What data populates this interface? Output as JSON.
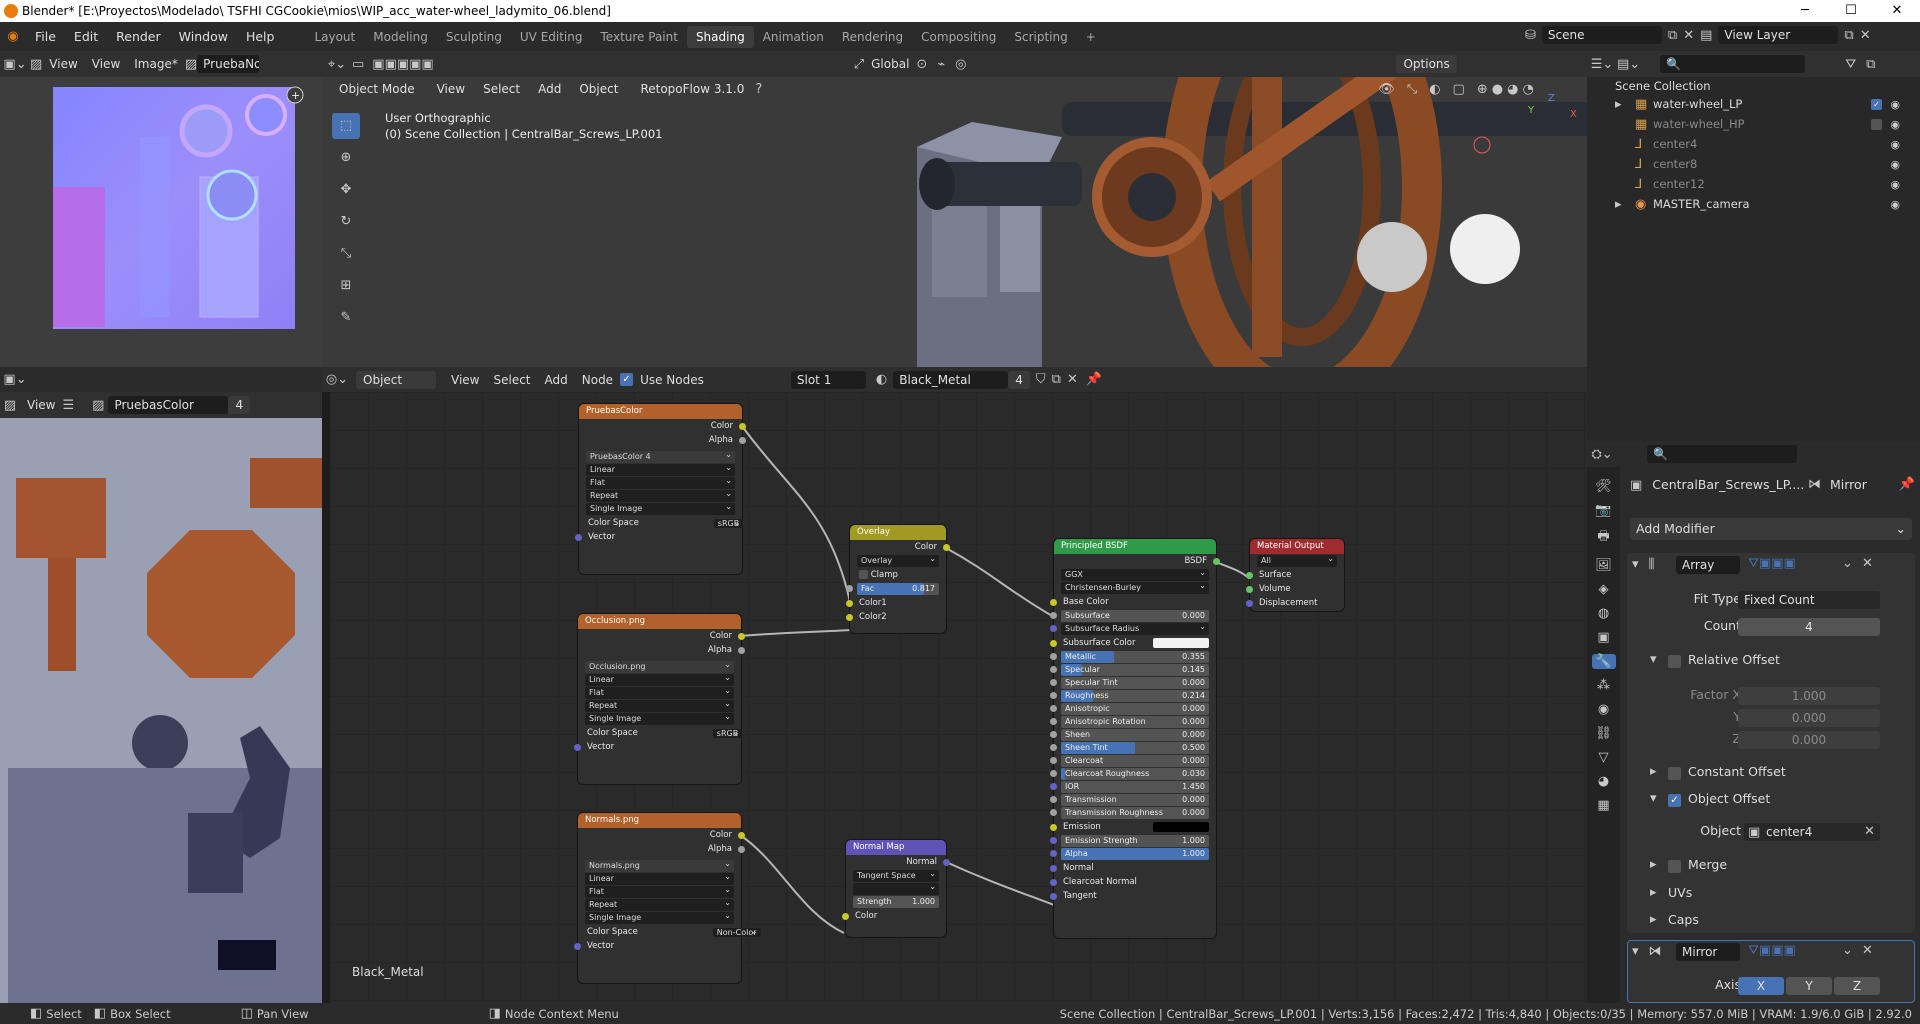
{
  "window": {
    "title": "Blender* [E:\\Proyectos\\Modelado\\ TSFHI CGCookie\\mios\\WIP_acc_water-wheel_ladymito_06.blend]",
    "min": "─",
    "max": "☐",
    "close": "✕"
  },
  "menu": [
    "File",
    "Edit",
    "Render",
    "Window",
    "Help"
  ],
  "workspaces": [
    "Layout",
    "Modeling",
    "Sculpting",
    "UV Editing",
    "Texture Paint",
    "Shading",
    "Animation",
    "Rendering",
    "Compositing",
    "Scripting"
  ],
  "workspace_add": "+",
  "scene": {
    "name": "Scene",
    "view_layer": "View Layer"
  },
  "image_editor_top": {
    "view": "View",
    "view2": "View",
    "image": "Image*",
    "image_name": "PruebaNorm"
  },
  "image_editor_bottom": {
    "view": "View",
    "image_name": "PruebasColor",
    "users": "4"
  },
  "viewport": {
    "transform": "Global",
    "options": "Options",
    "mode": "Object Mode",
    "view": "View",
    "select": "Select",
    "add": "Add",
    "object": "Object",
    "addon": "RetopoFlow 3.1.0",
    "view_name": "User Orthographic",
    "collection_path": "(0) Scene Collection | CentralBar_Screws_LP.001",
    "gizmo_x": "X",
    "gizmo_y": "Y",
    "gizmo_z": "Z"
  },
  "node_header": {
    "object": "Object",
    "view": "View",
    "select": "Select",
    "add": "Add",
    "node": "Node",
    "use_nodes": "Use Nodes",
    "slot": "Slot 1",
    "material": "Black_Metal",
    "users": "4"
  },
  "material_label": "Black_Metal",
  "nodes": {
    "pruebas": {
      "title": "PruebasColor",
      "out1": "Color",
      "out2": "Alpha",
      "img": "PruebasColor",
      "users": "4",
      "interp": "Linear",
      "proj": "Flat",
      "ext": "Repeat",
      "src": "Single Image",
      "cs_label": "Color Space",
      "cs": "sRGB",
      "vec": "Vector"
    },
    "occlusion": {
      "title": "Occlusion.png",
      "out1": "Color",
      "out2": "Alpha",
      "img": "Occlusion.png",
      "interp": "Linear",
      "proj": "Flat",
      "ext": "Repeat",
      "src": "Single Image",
      "cs_label": "Color Space",
      "cs": "sRGB",
      "vec": "Vector"
    },
    "normals": {
      "title": "Normals.png",
      "out1": "Color",
      "out2": "Alpha",
      "img": "Normals.png",
      "interp": "Linear",
      "proj": "Flat",
      "ext": "Repeat",
      "src": "Single Image",
      "cs_label": "Color Space",
      "cs": "Non-Color",
      "vec": "Vector"
    },
    "overlay": {
      "title": "Overlay",
      "out": "Color",
      "blend": "Overlay",
      "clamp": "Clamp",
      "fac": "Fac",
      "fac_val": "0.817",
      "c1": "Color1",
      "c2": "Color2"
    },
    "normalmap": {
      "title": "Normal Map",
      "out": "Normal",
      "space": "Tangent Space",
      "strength": "Strength",
      "strength_val": "1.000",
      "color": "Color"
    },
    "bsdf": {
      "title": "Principled BSDF",
      "out": "BSDF",
      "dist": "GGX",
      "sss": "Christensen-Burley",
      "base": "Base Color",
      "rows": [
        {
          "l": "Subsurface",
          "v": "0.000",
          "f": 0
        },
        {
          "l": "Subsurface Radius",
          "v": "",
          "f": 0,
          "sel": true
        },
        {
          "l": "Subsurface Color",
          "v": "",
          "f": 0,
          "white": true
        },
        {
          "l": "Metallic",
          "v": "0.355",
          "f": 0.355
        },
        {
          "l": "Specular",
          "v": "0.145",
          "f": 0.145
        },
        {
          "l": "Specular Tint",
          "v": "0.000",
          "f": 0
        },
        {
          "l": "Roughness",
          "v": "0.214",
          "f": 0.214
        },
        {
          "l": "Anisotropic",
          "v": "0.000",
          "f": 0
        },
        {
          "l": "Anisotropic Rotation",
          "v": "0.000",
          "f": 0
        },
        {
          "l": "Sheen",
          "v": "0.000",
          "f": 0
        },
        {
          "l": "Sheen Tint",
          "v": "0.500",
          "f": 0.5
        },
        {
          "l": "Clearcoat",
          "v": "0.000",
          "f": 0
        },
        {
          "l": "Clearcoat Roughness",
          "v": "0.030",
          "f": 0.03
        },
        {
          "l": "IOR",
          "v": "1.450",
          "f": 0
        },
        {
          "l": "Transmission",
          "v": "0.000",
          "f": 0
        },
        {
          "l": "Transmission Roughness",
          "v": "0.000",
          "f": 0
        },
        {
          "l": "Emission",
          "v": "",
          "f": 0,
          "black": true
        },
        {
          "l": "Emission Strength",
          "v": "1.000",
          "f": 0
        },
        {
          "l": "Alpha",
          "v": "1.000",
          "f": 1
        }
      ],
      "normal": "Normal",
      "cc_normal": "Clearcoat Normal",
      "tangent": "Tangent"
    },
    "matout": {
      "title": "Material Output",
      "target": "All",
      "surface": "Surface",
      "volume": "Volume",
      "disp": "Displacement"
    }
  },
  "outliner": {
    "title": "Scene Collection",
    "items": [
      {
        "name": "water-wheel_LP",
        "dim": false
      },
      {
        "name": "water-wheel_HP",
        "dim": true
      },
      {
        "name": "center4",
        "dim": true
      },
      {
        "name": "center8",
        "dim": true
      },
      {
        "name": "center12",
        "dim": true
      },
      {
        "name": "MASTER_camera",
        "dim": false
      }
    ]
  },
  "properties": {
    "object_name": "CentralBar_Screws_LP....",
    "modifier_name": "Mirror",
    "add_modifier": "Add Modifier",
    "array": {
      "name": "Array",
      "fit_type_label": "Fit Type",
      "fit_type": "Fixed Count",
      "count_label": "Count",
      "count": "4",
      "relative": "Relative Offset",
      "fx_label": "Factor X",
      "fx": "1.000",
      "fy_label": "Y",
      "fy": "0.000",
      "fz_label": "Z",
      "fz": "0.000",
      "constant": "Constant Offset",
      "object_offset": "Object Offset",
      "object_label": "Object",
      "object": "center4",
      "merge": "Merge",
      "uvs": "UVs",
      "caps": "Caps"
    },
    "mirror": {
      "name": "Mirror",
      "axis_label": "Axis",
      "x": "X",
      "y": "Y",
      "z": "Z"
    }
  },
  "status": {
    "select": "Select",
    "box_select": "Box Select",
    "pan": "Pan View",
    "context": "Node Context Menu",
    "stats": "Scene Collection | CentralBar_Screws_LP.001 | Verts:3,156 | Faces:2,472 | Tris:4,840 | Objects:0/35 | Memory: 557.0 MiB | VRAM: 1.9/6.0 GiB | 2.92.0"
  },
  "colors": {
    "accent": "#4772b3",
    "texture_head": "#b2612a",
    "shader_head": "#2f9b49",
    "output_head": "#9e2b30",
    "color_head": "#a09a22",
    "vector_head": "#5f53b8"
  }
}
